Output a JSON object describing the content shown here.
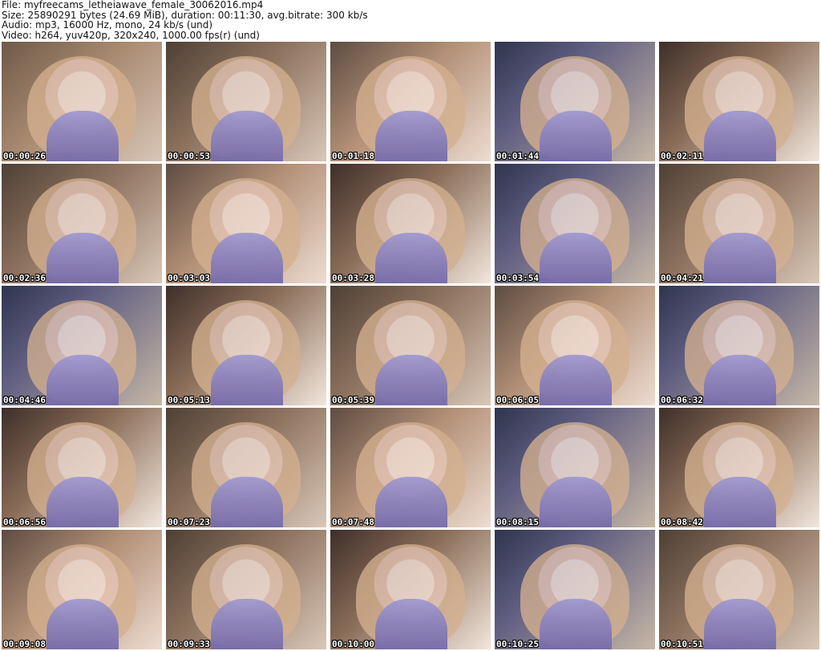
{
  "header": {
    "file": "File: myfreecams_letheiawave_female_30062016.mp4",
    "size": "Size: 25890291 bytes (24.69 MiB), duration: 00:11:30, avg.bitrate: 300 kb/s",
    "audio": "Audio: mp3, 16000 Hz, mono, 24 kb/s (und)",
    "video": "Video: h264, yuv420p, 320x240, 1000.00 fps(r) (und)"
  },
  "thumbnails": [
    {
      "time": "00:00:26"
    },
    {
      "time": "00:00:53"
    },
    {
      "time": "00:01:18"
    },
    {
      "time": "00:01:44"
    },
    {
      "time": "00:02:11"
    },
    {
      "time": "00:02:36"
    },
    {
      "time": "00:03:03"
    },
    {
      "time": "00:03:28"
    },
    {
      "time": "00:03:54"
    },
    {
      "time": "00:04:21"
    },
    {
      "time": "00:04:46"
    },
    {
      "time": "00:05:13"
    },
    {
      "time": "00:05:39"
    },
    {
      "time": "00:06:05"
    },
    {
      "time": "00:06:32"
    },
    {
      "time": "00:06:56"
    },
    {
      "time": "00:07:23"
    },
    {
      "time": "00:07:48"
    },
    {
      "time": "00:08:15"
    },
    {
      "time": "00:08:42"
    },
    {
      "time": "00:09:08"
    },
    {
      "time": "00:09:33"
    },
    {
      "time": "00:10:00"
    },
    {
      "time": "00:10:25"
    },
    {
      "time": "00:10:51"
    }
  ]
}
